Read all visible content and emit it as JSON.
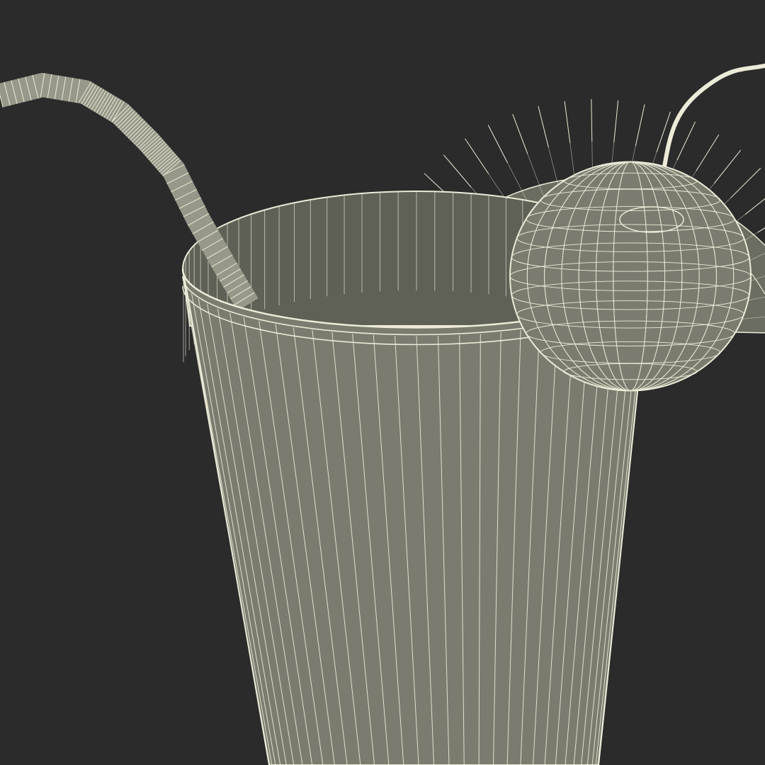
{
  "scene": {
    "subject": "wireframe-render",
    "objects": [
      "glass-icon",
      "straw-icon",
      "citrus-slice-icon",
      "cherry-icon"
    ],
    "colors": {
      "background": "#2b2b2b",
      "surface": "#7b7c6f",
      "surface_dark": "#6c6d61",
      "inner": "#606156",
      "wire": "#ecebd8"
    }
  }
}
